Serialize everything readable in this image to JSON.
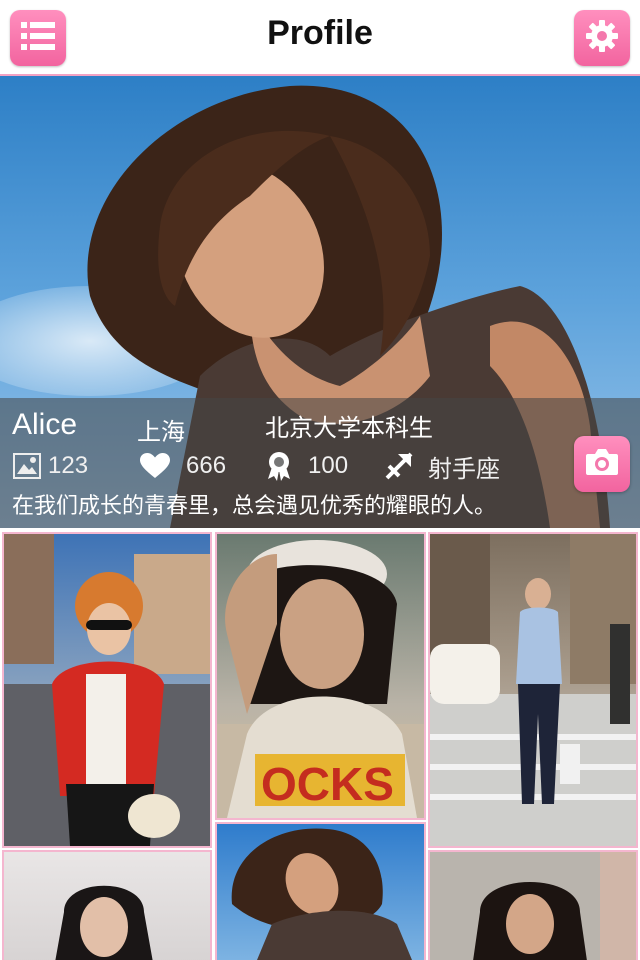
{
  "header": {
    "title": "Profile",
    "menu_icon": "list-icon",
    "settings_icon": "gear-icon"
  },
  "profile": {
    "name": "Alice",
    "city": "上海",
    "school": "北京大学本科生",
    "stats": {
      "photos": "123",
      "likes": "666",
      "awards": "100",
      "zodiac": "射手座"
    },
    "bio": "在我们成长的青春里，总会遇见优秀的耀眼的人。"
  },
  "colors": {
    "accent_pink": "#f2649f",
    "tile_border": "#f4b6cf"
  },
  "grid": {
    "tiles": [
      "photo-1",
      "photo-2",
      "photo-3",
      "photo-4",
      "photo-5",
      "photo-6"
    ]
  }
}
